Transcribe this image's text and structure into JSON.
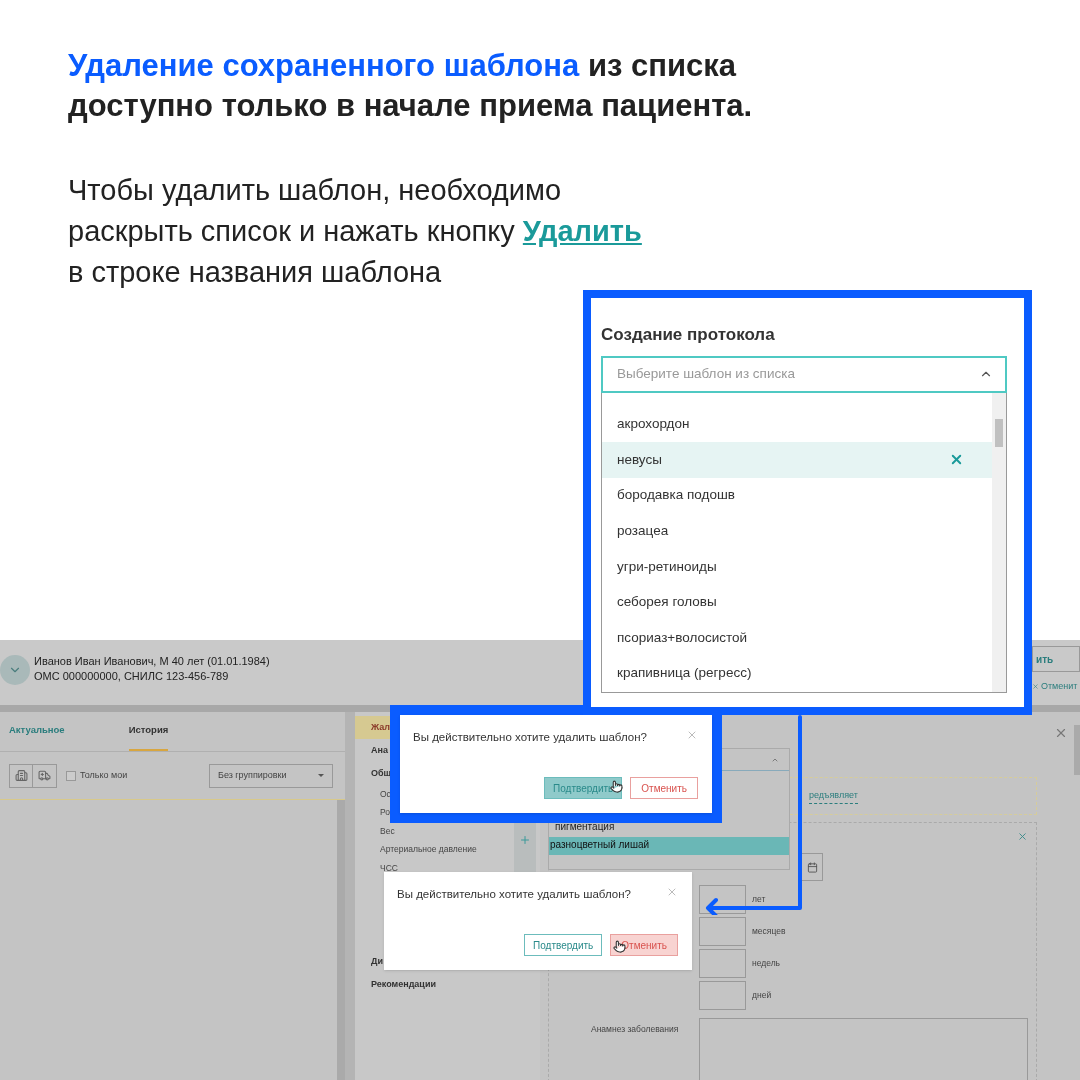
{
  "headline": {
    "highlight": "Удаление сохраненного шаблона",
    "lines": [
      "из списка",
      "доступно только в начале приема пациента."
    ]
  },
  "instruction": {
    "lines": [
      "Чтобы удалить шаблон, необходимо",
      "раскрыть список и нажать кнопку"
    ],
    "link": "Удалить",
    "last_line": "в строке названия шаблона"
  },
  "protocol_panel": {
    "title": "Создание протокола",
    "select": {
      "placeholder": "Выберите шаблон из списка",
      "expanded": true
    },
    "options": [
      {
        "label": "акрохордон",
        "selected": false
      },
      {
        "label": "невусы",
        "selected": true
      },
      {
        "label": "бородавка подошв",
        "selected": false
      },
      {
        "label": "розацеа",
        "selected": false
      },
      {
        "label": "угри-ретиноиды",
        "selected": false
      },
      {
        "label": "себорея головы",
        "selected": false
      },
      {
        "label": "псориаз+волосистой",
        "selected": false
      },
      {
        "label": "крапивница (регресс)",
        "selected": false
      }
    ]
  },
  "app": {
    "patient": {
      "name_line": "Иванов Иван Иванович, М 40 лет (01.01.1984)",
      "policy_line": "ОМС 000000000, СНИЛС 123-456-789"
    },
    "header_actions": [
      "ить",
      "Отменит"
    ],
    "tabs": [
      {
        "label": "Актуальное",
        "selected": false
      },
      {
        "label": "История",
        "selected": true
      }
    ],
    "only_mine": {
      "label": "Только мои",
      "checked": false
    },
    "grouping": "Без группировки",
    "sections": [
      {
        "label": "Жал",
        "selected": true
      },
      {
        "label": "Ана",
        "selected": false
      },
      {
        "label": "Общ",
        "selected": false,
        "children": [
          {
            "label": "Ос"
          },
          {
            "label": "Ро"
          },
          {
            "label": "Вес"
          },
          {
            "label": "Артериальное давление"
          },
          {
            "label": "ЧСС"
          }
        ]
      },
      {
        "label": "Ди",
        "selected": false
      },
      {
        "label": "Рекомендации",
        "selected": false
      }
    ],
    "template_options": [
      {
        "label": "пигментация",
        "selected": false
      },
      {
        "label": "разноцветный лишай",
        "selected": true
      }
    ],
    "complaint_link": "редъявляет",
    "duration_units": [
      "лет",
      "месяцев",
      "недель",
      "дней"
    ],
    "anamnesis_label": "Анамнез заболевания"
  },
  "dialogs": [
    {
      "question": "Вы действительно хотите удалить шаблон?",
      "buttons": [
        {
          "label": "Подтвердить",
          "kind": "confirm",
          "hovered": true
        },
        {
          "label": "Отменить",
          "kind": "cancel",
          "hovered": false
        }
      ],
      "highlighted": true
    },
    {
      "question": "Вы действительно хотите удалить шаблон?",
      "buttons": [
        {
          "label": "Подтвердить",
          "kind": "confirm",
          "hovered": false
        },
        {
          "label": "Отменить",
          "kind": "cancel",
          "hovered": true
        }
      ],
      "highlighted": false
    }
  ]
}
